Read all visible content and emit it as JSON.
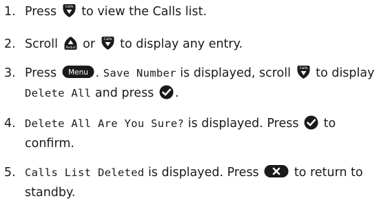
{
  "steps": [
    {
      "num": "1.",
      "parts": [
        {
          "t": "Press "
        },
        {
          "icon": "calls-down-key"
        },
        {
          "t": " to view the Calls list."
        }
      ]
    },
    {
      "num": "2.",
      "parts": [
        {
          "t": "Scroll "
        },
        {
          "icon": "redial-up-key"
        },
        {
          "t": " or "
        },
        {
          "icon": "calls-down-key"
        },
        {
          "t": " to display any entry."
        }
      ]
    },
    {
      "num": "3.",
      "parts": [
        {
          "t": "Press "
        },
        {
          "icon": "menu-key"
        },
        {
          "t": ". "
        },
        {
          "lcd": "Save Number"
        },
        {
          "t": " is displayed, scroll "
        },
        {
          "icon": "calls-down-key"
        },
        {
          "t": " to display "
        },
        {
          "lcd": "Delete All"
        },
        {
          "t": " and press "
        },
        {
          "icon": "ok-key"
        },
        {
          "t": "."
        }
      ]
    },
    {
      "num": "4.",
      "parts": [
        {
          "lcd": "Delete All Are You Sure?"
        },
        {
          "t": " is displayed. Press "
        },
        {
          "icon": "ok-key"
        },
        {
          "t": " to confirm."
        }
      ]
    },
    {
      "num": "5.",
      "parts": [
        {
          "lcd": "Calls List Deleted"
        },
        {
          "t": " is displayed. Press "
        },
        {
          "icon": "end-key"
        },
        {
          "t": " to return to standby."
        }
      ]
    }
  ],
  "icon_labels": {
    "calls": "Calls",
    "redial": "Redial",
    "menu": "Menu"
  },
  "colors": {
    "key_fill": "#1a1a1a",
    "key_text": "#ffffff",
    "body_text": "#1a1a1a"
  }
}
